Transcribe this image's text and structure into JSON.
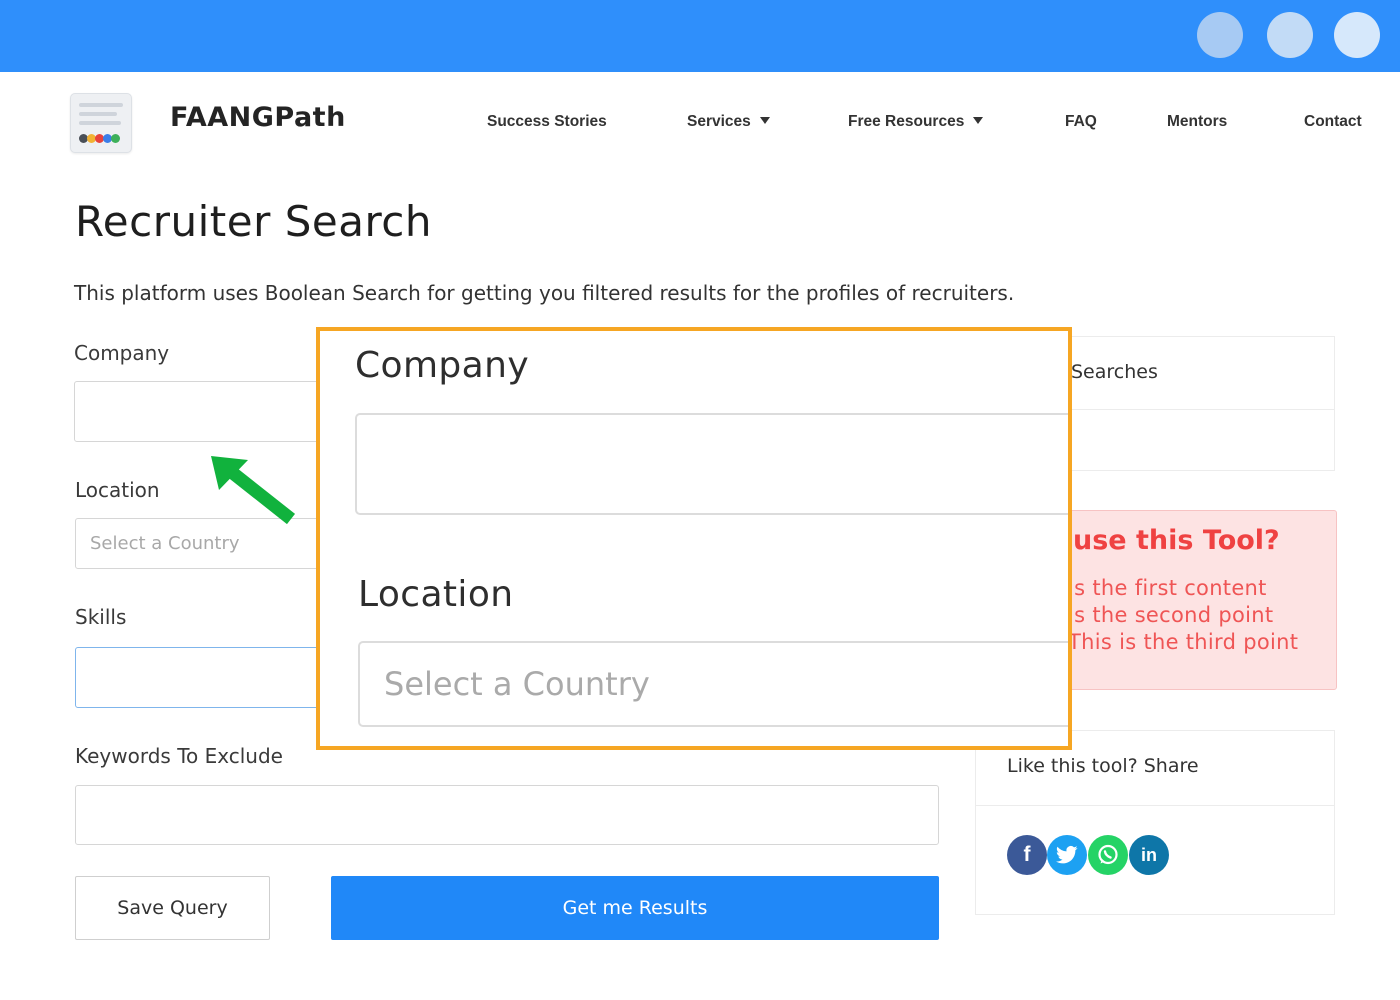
{
  "brand": {
    "name": "FAANGPath"
  },
  "nav": {
    "success_stories": "Success Stories",
    "services": "Services",
    "free_resources": "Free Resources",
    "faq": "FAQ",
    "mentors": "Mentors",
    "contact": "Contact"
  },
  "page": {
    "title": "Recruiter Search",
    "description": "This platform uses Boolean Search for getting you filtered results for the profiles of recruiters."
  },
  "form": {
    "company_label": "Company",
    "company_value": "",
    "location_label": "Location",
    "location_placeholder": "Select a Country",
    "skills_label": "Skills",
    "skills_value": "",
    "exclude_label": "Keywords To Exclude",
    "exclude_value": "",
    "save_button": "Save Query",
    "submit_button": "Get me Results"
  },
  "sidebar": {
    "searches_title": "Searches",
    "tip_title": "use this Tool?",
    "tip_lines": [
      "is the first content",
      "is the second point",
      "This is the third point"
    ],
    "share_title": "Like this tool? Share",
    "share_icons": [
      "facebook-icon",
      "twitter-icon",
      "whatsapp-icon",
      "linkedin-icon"
    ]
  },
  "zoom": {
    "company_label": "Company",
    "location_label": "Location",
    "location_placeholder": "Select a Country"
  },
  "colors": {
    "topbar": "#2f8ffb",
    "primary_button": "#2088f8",
    "zoom_border": "#f6a623",
    "tip_background": "#fde3e3",
    "tip_text": "#ef4242",
    "arrow": "#11b23d",
    "facebook": "#3b5998",
    "twitter": "#1da1f2",
    "whatsapp": "#25d366",
    "linkedin": "#0e76a8"
  }
}
